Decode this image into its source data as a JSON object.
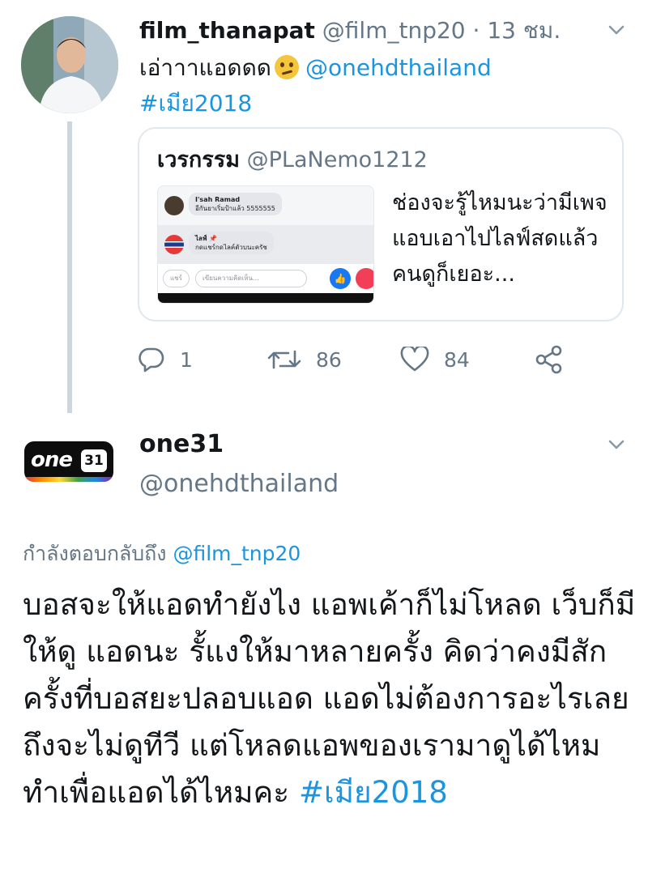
{
  "tweet1": {
    "display_name": "film_thanapat",
    "handle": "@film_tnp20",
    "separator": "·",
    "time": "13 ชม.",
    "text": "เอ่าาาแอดดด",
    "mention": "@onehdthailand",
    "hashtag": "#เมีย2018",
    "emoji": "face-with-rolling-eyes",
    "quote": {
      "display_name": "เวรกรรม",
      "handle": "@PLaNemo1212",
      "text": "ช่องจะรู้ไหมนะว่ามีเพจแอบเอาไปไลฟ์สดแล้วคนดูก็เยอะ...",
      "thumbnail": {
        "comment1_name": "I'sah Ramad",
        "comment1_text": "อีกันยาเริ่มป้าแล้ว 5555555",
        "comment2_name": "ไลฟ์ 📌",
        "comment2_text": "กดแชร์กดไลค์ตัวบนะครัช",
        "share_label": "แชร์",
        "comment_placeholder": "เขียนความคิดเห็น..."
      }
    },
    "actions": {
      "reply_count": "1",
      "retweet_count": "86",
      "like_count": "84"
    }
  },
  "tweet2": {
    "display_name": "one31",
    "handle": "@onehdthailand",
    "logo_text": "one",
    "logo_badge": "31",
    "reply_prefix": "กำลังตอบกลับถึง",
    "reply_to": "@film_tnp20",
    "body": "บอสจะให้แอดทำยังไง แอพเค้าก็ไม่โหลด เว็บก็มีให้ดู แอดนะ รั้แงให้มาหลายครั้ง คิดว่าคงมีสักครั้งที่บอสยะปลอบแอด แอดไม่ต้องการอะไรเลย ถึงจะไม่ดูทีวี แต่โหลดแอพของเรามาดูได้ไหม  ทำเพื่อแอดได้ไหมคะ",
    "hashtag": "#เมีย2018"
  },
  "colors": {
    "link": "#1b95e0",
    "muted": "#657786",
    "text": "#14171a",
    "thread_line": "#cdd6dd",
    "border": "#e1e8ed"
  }
}
